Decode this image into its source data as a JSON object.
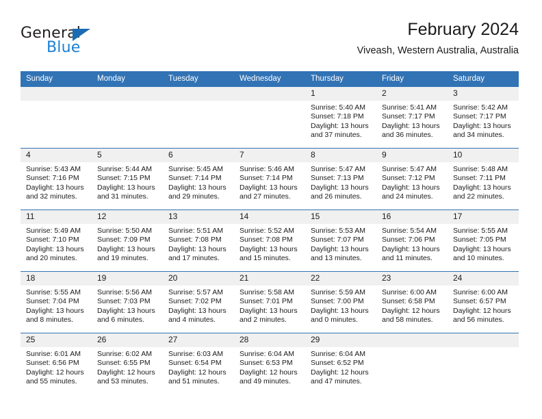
{
  "brand": {
    "name_top": "General",
    "name_bottom": "Blue",
    "triangle_color": "#1b6cb3",
    "blue_color": "#1b7fd4"
  },
  "header": {
    "title": "February 2024",
    "location": "Viveash, Western Australia, Australia"
  },
  "theme": {
    "header_bar": "#3173b5",
    "daynum_band": "#f0f0f0",
    "text": "#1a1a1a"
  },
  "calendar": {
    "weekdays": [
      "Sunday",
      "Monday",
      "Tuesday",
      "Wednesday",
      "Thursday",
      "Friday",
      "Saturday"
    ],
    "weeks": [
      [
        {
          "day": ""
        },
        {
          "day": ""
        },
        {
          "day": ""
        },
        {
          "day": ""
        },
        {
          "day": "1",
          "sunrise": "Sunrise: 5:40 AM",
          "sunset": "Sunset: 7:18 PM",
          "daylight": "Daylight: 13 hours and 37 minutes."
        },
        {
          "day": "2",
          "sunrise": "Sunrise: 5:41 AM",
          "sunset": "Sunset: 7:17 PM",
          "daylight": "Daylight: 13 hours and 36 minutes."
        },
        {
          "day": "3",
          "sunrise": "Sunrise: 5:42 AM",
          "sunset": "Sunset: 7:17 PM",
          "daylight": "Daylight: 13 hours and 34 minutes."
        }
      ],
      [
        {
          "day": "4",
          "sunrise": "Sunrise: 5:43 AM",
          "sunset": "Sunset: 7:16 PM",
          "daylight": "Daylight: 13 hours and 32 minutes."
        },
        {
          "day": "5",
          "sunrise": "Sunrise: 5:44 AM",
          "sunset": "Sunset: 7:15 PM",
          "daylight": "Daylight: 13 hours and 31 minutes."
        },
        {
          "day": "6",
          "sunrise": "Sunrise: 5:45 AM",
          "sunset": "Sunset: 7:14 PM",
          "daylight": "Daylight: 13 hours and 29 minutes."
        },
        {
          "day": "7",
          "sunrise": "Sunrise: 5:46 AM",
          "sunset": "Sunset: 7:14 PM",
          "daylight": "Daylight: 13 hours and 27 minutes."
        },
        {
          "day": "8",
          "sunrise": "Sunrise: 5:47 AM",
          "sunset": "Sunset: 7:13 PM",
          "daylight": "Daylight: 13 hours and 26 minutes."
        },
        {
          "day": "9",
          "sunrise": "Sunrise: 5:47 AM",
          "sunset": "Sunset: 7:12 PM",
          "daylight": "Daylight: 13 hours and 24 minutes."
        },
        {
          "day": "10",
          "sunrise": "Sunrise: 5:48 AM",
          "sunset": "Sunset: 7:11 PM",
          "daylight": "Daylight: 13 hours and 22 minutes."
        }
      ],
      [
        {
          "day": "11",
          "sunrise": "Sunrise: 5:49 AM",
          "sunset": "Sunset: 7:10 PM",
          "daylight": "Daylight: 13 hours and 20 minutes."
        },
        {
          "day": "12",
          "sunrise": "Sunrise: 5:50 AM",
          "sunset": "Sunset: 7:09 PM",
          "daylight": "Daylight: 13 hours and 19 minutes."
        },
        {
          "day": "13",
          "sunrise": "Sunrise: 5:51 AM",
          "sunset": "Sunset: 7:08 PM",
          "daylight": "Daylight: 13 hours and 17 minutes."
        },
        {
          "day": "14",
          "sunrise": "Sunrise: 5:52 AM",
          "sunset": "Sunset: 7:08 PM",
          "daylight": "Daylight: 13 hours and 15 minutes."
        },
        {
          "day": "15",
          "sunrise": "Sunrise: 5:53 AM",
          "sunset": "Sunset: 7:07 PM",
          "daylight": "Daylight: 13 hours and 13 minutes."
        },
        {
          "day": "16",
          "sunrise": "Sunrise: 5:54 AM",
          "sunset": "Sunset: 7:06 PM",
          "daylight": "Daylight: 13 hours and 11 minutes."
        },
        {
          "day": "17",
          "sunrise": "Sunrise: 5:55 AM",
          "sunset": "Sunset: 7:05 PM",
          "daylight": "Daylight: 13 hours and 10 minutes."
        }
      ],
      [
        {
          "day": "18",
          "sunrise": "Sunrise: 5:55 AM",
          "sunset": "Sunset: 7:04 PM",
          "daylight": "Daylight: 13 hours and 8 minutes."
        },
        {
          "day": "19",
          "sunrise": "Sunrise: 5:56 AM",
          "sunset": "Sunset: 7:03 PM",
          "daylight": "Daylight: 13 hours and 6 minutes."
        },
        {
          "day": "20",
          "sunrise": "Sunrise: 5:57 AM",
          "sunset": "Sunset: 7:02 PM",
          "daylight": "Daylight: 13 hours and 4 minutes."
        },
        {
          "day": "21",
          "sunrise": "Sunrise: 5:58 AM",
          "sunset": "Sunset: 7:01 PM",
          "daylight": "Daylight: 13 hours and 2 minutes."
        },
        {
          "day": "22",
          "sunrise": "Sunrise: 5:59 AM",
          "sunset": "Sunset: 7:00 PM",
          "daylight": "Daylight: 13 hours and 0 minutes."
        },
        {
          "day": "23",
          "sunrise": "Sunrise: 6:00 AM",
          "sunset": "Sunset: 6:58 PM",
          "daylight": "Daylight: 12 hours and 58 minutes."
        },
        {
          "day": "24",
          "sunrise": "Sunrise: 6:00 AM",
          "sunset": "Sunset: 6:57 PM",
          "daylight": "Daylight: 12 hours and 56 minutes."
        }
      ],
      [
        {
          "day": "25",
          "sunrise": "Sunrise: 6:01 AM",
          "sunset": "Sunset: 6:56 PM",
          "daylight": "Daylight: 12 hours and 55 minutes."
        },
        {
          "day": "26",
          "sunrise": "Sunrise: 6:02 AM",
          "sunset": "Sunset: 6:55 PM",
          "daylight": "Daylight: 12 hours and 53 minutes."
        },
        {
          "day": "27",
          "sunrise": "Sunrise: 6:03 AM",
          "sunset": "Sunset: 6:54 PM",
          "daylight": "Daylight: 12 hours and 51 minutes."
        },
        {
          "day": "28",
          "sunrise": "Sunrise: 6:04 AM",
          "sunset": "Sunset: 6:53 PM",
          "daylight": "Daylight: 12 hours and 49 minutes."
        },
        {
          "day": "29",
          "sunrise": "Sunrise: 6:04 AM",
          "sunset": "Sunset: 6:52 PM",
          "daylight": "Daylight: 12 hours and 47 minutes."
        },
        {
          "day": ""
        },
        {
          "day": ""
        }
      ]
    ]
  }
}
